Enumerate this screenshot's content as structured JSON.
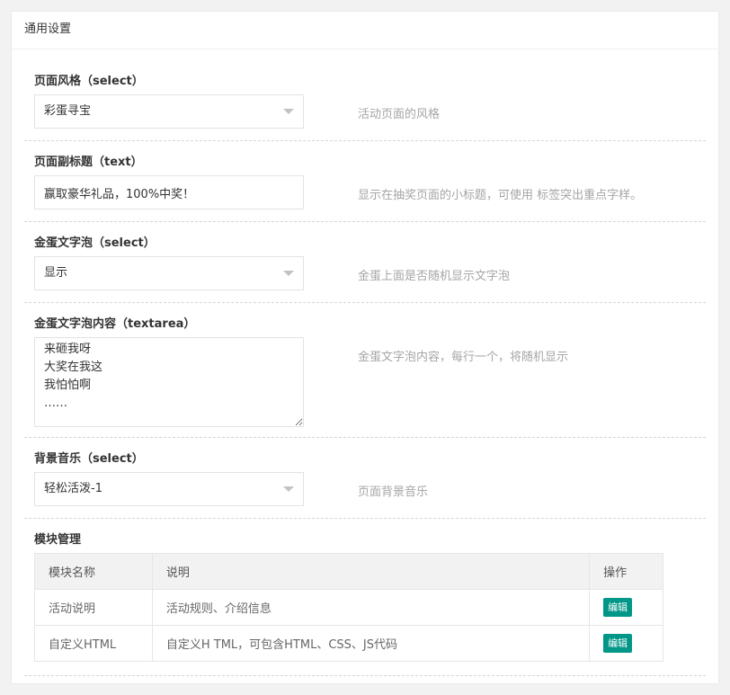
{
  "panel": {
    "title": "通用设置"
  },
  "fields": [
    {
      "label": "页面风格（select）",
      "value": "彩蛋寻宝",
      "hint": "活动页面的风格"
    },
    {
      "label": "页面副标题（text）",
      "value": "赢取豪华礼品，100%中奖！",
      "hint": "显示在抽奖页面的小标题，可使用 标签突出重点字样。"
    },
    {
      "label": "金蛋文字泡（select）",
      "value": "显示",
      "hint": "金蛋上面是否随机显示文字泡"
    },
    {
      "label": "金蛋文字泡内容（textarea）",
      "value": "来砸我呀\n大奖在我这\n我怕怕啊\n……",
      "hint": "金蛋文字泡内容，每行一个，将随机显示"
    },
    {
      "label": "背景音乐（select）",
      "value": "轻松活泼-1",
      "hint": "页面背景音乐"
    }
  ],
  "modules": {
    "label": "模块管理",
    "columns": [
      "模块名称",
      "说明",
      "操作"
    ],
    "rows": [
      {
        "name": "活动说明",
        "desc": "活动规则、介绍信息",
        "action": "编辑"
      },
      {
        "name": "自定义HTML",
        "desc": "自定义H TML，可包含HTML、CSS、JS代码",
        "action": "编辑"
      }
    ]
  },
  "colors": {
    "accent": "#009688",
    "hint": "#a5a5a5"
  }
}
